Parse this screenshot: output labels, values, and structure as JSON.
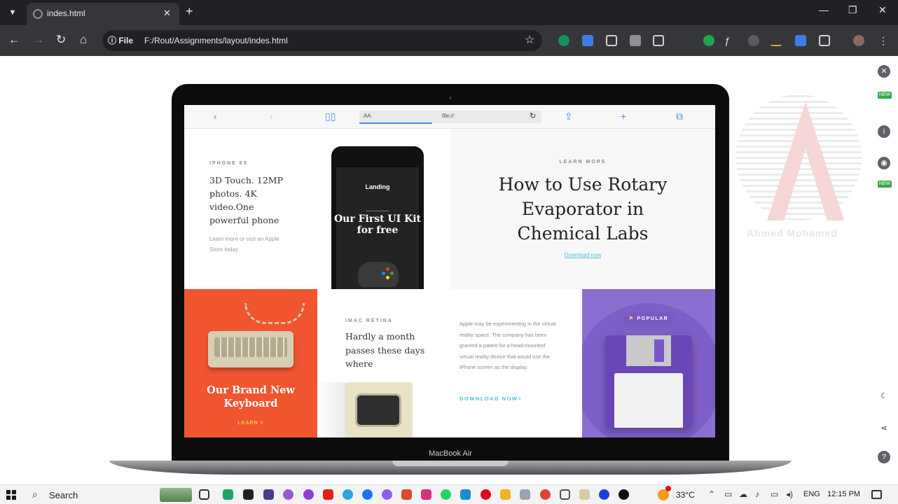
{
  "browser": {
    "tab_title": "indes.html",
    "site_chip": "File",
    "url": "F:/Rout/Assignments/layout/indes.html"
  },
  "watermark": {
    "name": "Ahmed Mohamed"
  },
  "laptop": {
    "label": "MacBook Air"
  },
  "safari": {
    "aa": "AA",
    "url": "file://"
  },
  "hero_left": {
    "eyebrow": "IPHONE 6S",
    "title": "3D Touch. 12MP photos. 4K video.One powerful phone",
    "subtitle": "Learn more or visit an Apple Store today",
    "phone_logo": "Landing",
    "phone_title": "Our First UI Kit for free"
  },
  "hero_right": {
    "eyebrow": "LEARN MORE",
    "title": "How to Use Rotary Evaporator in Chemical Labs",
    "link": "Download now"
  },
  "tiles": {
    "keyboard_title": "Our Brand New Keyboard",
    "keyboard_link": "LEARN >",
    "imac_eyebrow": "IMAC RETINA",
    "imac_title": "Hardly a month passes these days where",
    "apple_text": "Apple may be experimenting in the virtual reality space. The company has been granted a patent for a head-mounted virtual reality device that would use the iPhone screen as the display.",
    "download_link": "DOWNLOAD NOW>",
    "popular_badge": "POPULAR"
  },
  "taskbar": {
    "search": "Search",
    "temperature": "33°C",
    "language": "ENG",
    "time": "12:15 PM"
  },
  "colors": {
    "accent_teal": "#4ec1d1",
    "keyboard_tile": "#f0552f",
    "floppy_tile": "#8b6fd0"
  }
}
